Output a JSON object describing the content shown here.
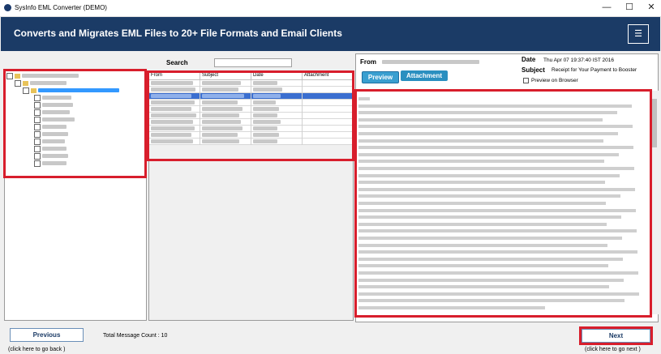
{
  "window": {
    "title": "SysInfo EML Converter (DEMO)",
    "minimize": "—",
    "maximize": "☐",
    "close": "✕"
  },
  "header": {
    "title": "Converts and Migrates EML Files to 20+ File Formats and Email Clients",
    "menu_icon": "☰"
  },
  "search": {
    "label": "Search",
    "value": ""
  },
  "grid": {
    "columns": [
      "From",
      "Subject",
      "Date",
      "Attachment"
    ],
    "row_count": 10,
    "selected_row": 2
  },
  "preview": {
    "from_label": "From",
    "from_value": "",
    "date_label": "Date",
    "date_value": "Thu Apr 07 19:37:40 IST 2016",
    "subject_label": "Subject",
    "subject_value": "Receipt for Your Payment to Booster",
    "preview_tab": "Preview",
    "attachment_tab": "Attachment",
    "browser_checkbox_label": "Preview on Browser"
  },
  "footer": {
    "previous_label": "Previous",
    "previous_hint": "(click here to  go back )",
    "message_count_label": "Total Message Count : 10",
    "next_label": "Next",
    "next_hint": "(click here to  go next )"
  },
  "colors": {
    "header_bg": "#1b3b66",
    "tab_bg": "#2a8fc0",
    "highlight": "#d81e2c"
  }
}
